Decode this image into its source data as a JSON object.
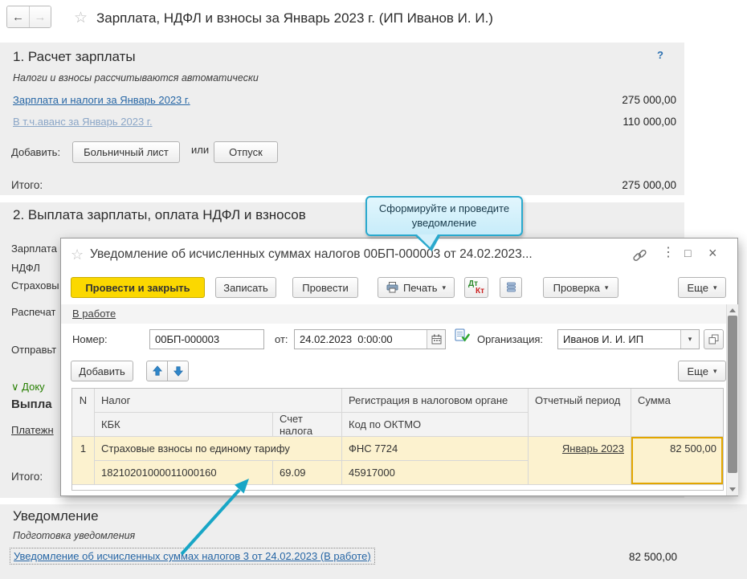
{
  "icons": {
    "star": "☆",
    "back": "←",
    "forward": "→",
    "help": "?",
    "kebab": "⋮",
    "maximize": "□",
    "close": "×",
    "dropdown": "▾",
    "chevron_down": "∨"
  },
  "page": {
    "title": "Зарплата, НДФЛ и взносы за Январь 2023 г. (ИП Иванов И. И.)"
  },
  "salary_section": {
    "heading": "1. Расчет зарплаты",
    "subtitle": "Налоги и взносы рассчитываются автоматически",
    "rows": [
      {
        "label": "Зарплата и налоги за Январь 2023 г.",
        "value": "275 000,00"
      },
      {
        "label": "В т.ч.аванс за Январь 2023 г.",
        "value": "110 000,00"
      }
    ],
    "add_label": "Добавить:",
    "sick_button": "Больничный лист",
    "or_label": "или",
    "vacation_button": "Отпуск",
    "total_label": "Итого:",
    "total_value": "275 000,00"
  },
  "payment_section": {
    "heading": "2. Выплата зарплаты, оплата НДФЛ и взносов",
    "labels": {
      "salary": "Зарплата",
      "ndfl": "НДФЛ",
      "insurance": "Страховы",
      "print": "Распечат",
      "send": "Отправьт",
      "documents": "Доку",
      "payout": "Выпла",
      "payment": "Платежн",
      "total": "Итого:"
    }
  },
  "tooltip": {
    "text": "Сформируйте и проведите уведомление"
  },
  "modal": {
    "title": "Уведомление об исчисленных суммах налогов 00БП-000003 от 24.02.2023...",
    "toolbar": {
      "post_and_close": "Провести и закрыть",
      "save": "Записать",
      "post": "Провести",
      "print": "Печать",
      "dt": "Дт",
      "kt": "Кт",
      "verify": "Проверка",
      "more": "Еще"
    },
    "status": "В работе",
    "fields": {
      "number_label": "Номер:",
      "number": "00БП-000003",
      "date_label": "от:",
      "date": "24.02.2023  0:00:00",
      "org_label": "Организация:",
      "org": "Иванов И. И. ИП"
    },
    "commands": {
      "add": "Добавить",
      "more": "Еще"
    },
    "table": {
      "header": {
        "n": "N",
        "tax": "Налог",
        "kbk": "КБК",
        "account": "Счет налога",
        "registration": "Регистрация в налоговом органе",
        "oktmo": "Код по ОКТМО",
        "period": "Отчетный период",
        "sum": "Сумма"
      },
      "rows": [
        {
          "n": "1",
          "tax": "Страховые взносы по единому тарифу",
          "registration": "ФНС 7724",
          "period": "Январь 2023",
          "sum": "82 500,00",
          "kbk": "18210201000011000160",
          "account": "69.09",
          "oktmo": "45917000"
        }
      ]
    }
  },
  "notification_section": {
    "heading": "Уведомление",
    "subtitle": "Подготовка уведомления",
    "link": "Уведомление об исчисленных суммах налогов 3 от 24.02.2023 (В работе)",
    "value": "82 500,00"
  },
  "colors": {
    "accent_yellow": "#fbd800",
    "link_blue": "#2666a5",
    "link_faded": "#8ba6c7",
    "green_section": "#267f00",
    "row_highlight": "#fcf2cf",
    "selection_border": "#e2a600",
    "tooltip_border": "#2aa9cd",
    "tooltip_bg": "#cfeefb",
    "arrow_teal": "#18a6c6"
  }
}
